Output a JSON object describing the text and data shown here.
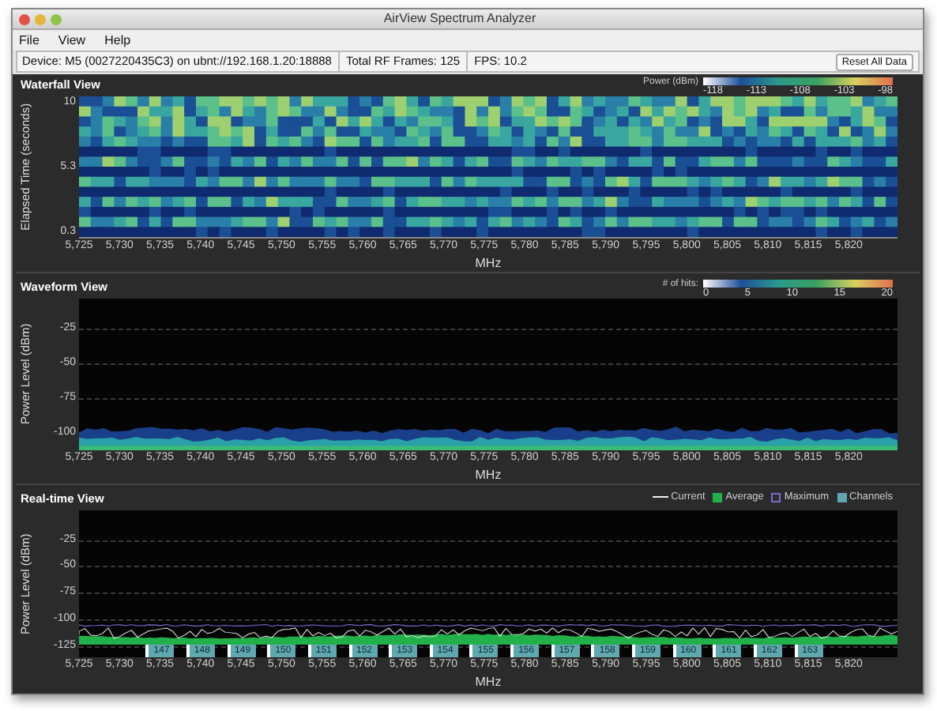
{
  "window": {
    "title": "AirView Spectrum Analyzer"
  },
  "menu": [
    "File",
    "View",
    "Help"
  ],
  "info_bar": {
    "device": "Device: M5 (0027220435C3) on ubnt://192.168.1.20:18888",
    "frames": "Total RF Frames: 125",
    "fps": "FPS: 10.2",
    "button": "Reset All Data"
  },
  "waterfall": {
    "title": "Waterfall View",
    "legend_title": "Power (dBm)",
    "legend_ticks": [
      "-118",
      "-113",
      "-108",
      "-103",
      "-98"
    ],
    "ylabel": "Elapsed Time (seconds)",
    "yticks": [
      "10",
      "5.3",
      "0.3"
    ],
    "xlabel": "MHz",
    "xticks": [
      "5,725",
      "5,730",
      "5,735",
      "5,740",
      "5,745",
      "5,750",
      "5,755",
      "5,760",
      "5,765",
      "5,770",
      "5,775",
      "5,780",
      "5,785",
      "5,790",
      "5,795",
      "5,800",
      "5,805",
      "5,810",
      "5,815",
      "5,820"
    ]
  },
  "waveform": {
    "title": "Waveform View",
    "legend_title": "# of hits:",
    "legend_ticks": [
      "0",
      "5",
      "10",
      "15",
      "20"
    ],
    "ylabel": "Power Level (dBm)",
    "yticks": [
      "-25",
      "-50",
      "-75",
      "-100"
    ],
    "xlabel": "MHz",
    "xticks": [
      "5,725",
      "5,730",
      "5,735",
      "5,740",
      "5,745",
      "5,750",
      "5,755",
      "5,760",
      "5,765",
      "5,770",
      "5,775",
      "5,780",
      "5,785",
      "5,790",
      "5,795",
      "5,800",
      "5,805",
      "5,810",
      "5,815",
      "5,820"
    ]
  },
  "realtime": {
    "title": "Real-time View",
    "legend": [
      {
        "kind": "line",
        "label": "Current"
      },
      {
        "kind": "fill",
        "label": "Average"
      },
      {
        "kind": "outline",
        "label": "Maximum"
      },
      {
        "kind": "box",
        "label": "Channels"
      }
    ],
    "ylabel": "Power Level (dBm)",
    "yticks": [
      "-25",
      "-50",
      "-75",
      "-100",
      "-125"
    ],
    "xlabel": "MHz",
    "xticks": [
      "5,725",
      "5,730",
      "5,735",
      "5,740",
      "5,745",
      "5,750",
      "5,755",
      "5,760",
      "5,765",
      "5,770",
      "5,775",
      "5,780",
      "5,785",
      "5,790",
      "5,795",
      "5,800",
      "5,805",
      "5,810",
      "5,815",
      "5,820"
    ],
    "channels": [
      "147",
      "148",
      "149",
      "150",
      "151",
      "152",
      "153",
      "154",
      "155",
      "156",
      "157",
      "158",
      "159",
      "160",
      "161",
      "162",
      "163"
    ]
  }
}
